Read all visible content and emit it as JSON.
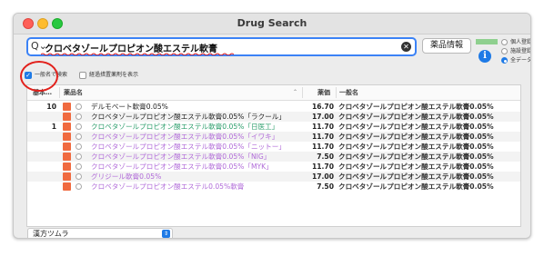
{
  "window": {
    "title": "Drug Search"
  },
  "search": {
    "value": "クロベタゾールプロピオン酸エステル軟膏",
    "search_icon": "search-icon",
    "clear_icon": "clear-icon"
  },
  "info_button": {
    "label": "薬品情報"
  },
  "info_icon": {
    "glyph": "i"
  },
  "filters": [
    {
      "label": "個人登録",
      "selected": false
    },
    {
      "label": "施設登録",
      "selected": false
    },
    {
      "label": "全データ",
      "selected": true
    }
  ],
  "options": {
    "generic_search": {
      "label": "一般名で検索",
      "checked": true
    },
    "show_discontinued": {
      "label": "経過措置薬剤を表示",
      "checked": false
    }
  },
  "table": {
    "headers": {
      "count": "基本…",
      "name": "薬品名",
      "price": "薬価",
      "generic": "一般名"
    },
    "rows": [
      {
        "count": "10",
        "color": "#f06a3f",
        "name": "デルモベート軟膏0.05%",
        "name_color": "#222222",
        "price": "16.70",
        "generic": "クロベタゾールプロピオン酸エステル軟膏0.05%"
      },
      {
        "count": "",
        "color": "#f06a3f",
        "name": "クロベタゾールプロピオン酸エステル軟膏0.05%「ラクール」",
        "name_color": "#222222",
        "price": "17.00",
        "generic": "クロベタゾールプロピオン酸エステル軟膏0.05%"
      },
      {
        "count": "1",
        "color": "#f06a3f",
        "name": "クロベタゾールプロピオン酸エステル軟膏0.05%「日医工」",
        "name_color": "#2a9d6a",
        "price": "11.70",
        "generic": "クロベタゾールプロピオン酸エステル軟膏0.05%"
      },
      {
        "count": "",
        "color": "#f06a3f",
        "name": "クロベタゾールプロピオン酸エステル軟膏0.05%「イワキ」",
        "name_color": "#b06ad8",
        "price": "11.70",
        "generic": "クロベタゾールプロピオン酸エステル軟膏0.05%"
      },
      {
        "count": "",
        "color": "#f06a3f",
        "name": "クロベタゾールプロピオン酸エステル軟膏0.05%「ニットー」",
        "name_color": "#b06ad8",
        "price": "11.70",
        "generic": "クロベタゾールプロピオン酸エステル軟膏0.05%"
      },
      {
        "count": "",
        "color": "#f06a3f",
        "name": "クロベタゾールプロピオン酸エステル軟膏0.05%「NIG」",
        "name_color": "#b06ad8",
        "price": "7.50",
        "generic": "クロベタゾールプロピオン酸エステル軟膏0.05%"
      },
      {
        "count": "",
        "color": "#f06a3f",
        "name": "クロベタゾールプロピオン酸エステル軟膏0.05%「MYK」",
        "name_color": "#b06ad8",
        "price": "11.70",
        "generic": "クロベタゾールプロピオン酸エステル軟膏0.05%"
      },
      {
        "count": "",
        "color": "#f06a3f",
        "name": "グリジール軟膏0.05%",
        "name_color": "#b06ad8",
        "price": "17.00",
        "generic": "クロベタゾールプロピオン酸エステル軟膏0.05%"
      },
      {
        "count": "",
        "color": "#f06a3f",
        "name": "クロベタゾールプロピオン酸エステル0.05%軟膏",
        "name_color": "#b06ad8",
        "price": "7.50",
        "generic": "クロベタゾールプロピオン酸エステル軟膏0.05%"
      }
    ]
  },
  "maker_select": {
    "value": "漢方ツムラ"
  }
}
